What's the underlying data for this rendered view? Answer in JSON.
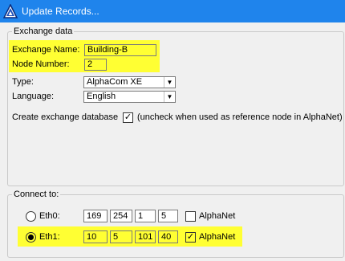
{
  "window": {
    "title": "Update Records..."
  },
  "exchange": {
    "legend": "Exchange data",
    "name_label": "Exchange Name:",
    "name_value": "Building-B",
    "node_label": "Node Number:",
    "node_value": "2",
    "type_label": "Type:",
    "type_value": "AlphaCom XE",
    "language_label": "Language:",
    "language_value": "English",
    "create_db_label": "Create exchange database",
    "create_db_checked": true,
    "create_db_note": "(uncheck when used as reference node in AlphaNet)"
  },
  "connect": {
    "legend": "Connect to:",
    "eth0": {
      "label": "Eth0:",
      "selected": false,
      "ip": [
        "169",
        "254",
        "1",
        "5"
      ],
      "alphanet_label": "AlphaNet",
      "alphanet_checked": false
    },
    "eth1": {
      "label": "Eth1:",
      "selected": true,
      "ip": [
        "10",
        "5",
        "101",
        "40"
      ],
      "alphanet_label": "AlphaNet",
      "alphanet_checked": true
    }
  },
  "icons": {
    "app": "alphacom-triangle-icon",
    "check": "✓",
    "dropdown": "▼"
  },
  "colors": {
    "titlebar": "#1f84ec",
    "highlight": "#ffff33",
    "window_bg": "#f0f0f0"
  }
}
